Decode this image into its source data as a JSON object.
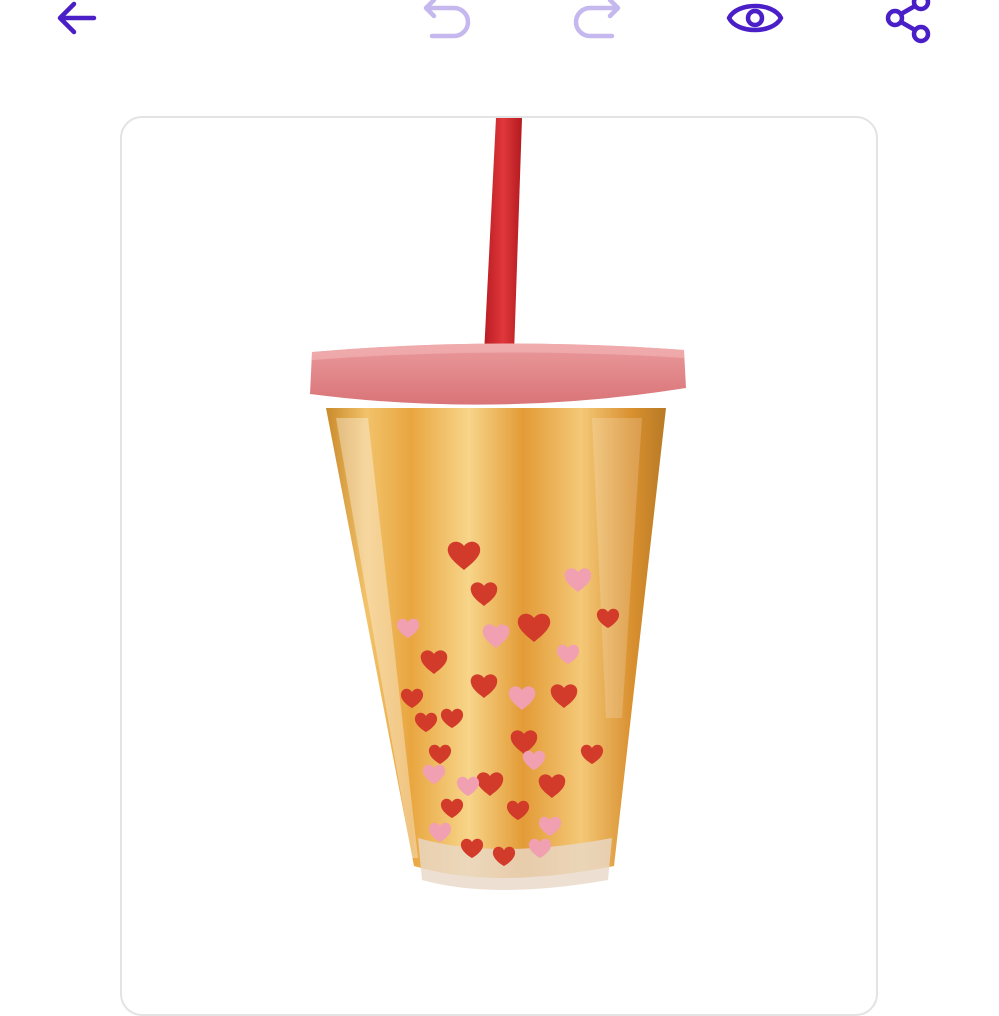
{
  "toolbar": {
    "back": {
      "icon": "arrow-left-icon",
      "enabled": true
    },
    "undo": {
      "icon": "undo-icon",
      "enabled": false
    },
    "redo": {
      "icon": "redo-icon",
      "enabled": false
    },
    "preview": {
      "icon": "eye-icon",
      "enabled": true
    },
    "share": {
      "icon": "share-icon",
      "enabled": true
    }
  },
  "colors": {
    "accent": "#4a1fc7",
    "accent_disabled": "#c5b8ee",
    "card_border": "#e3e3e6",
    "straw": "#d7262b",
    "lid": "#e07f84",
    "cup_gold": "#e9a640",
    "heart_red": "#d23a2a",
    "heart_pink": "#f0a0b0"
  },
  "main": {
    "image": {
      "subject": "tumbler-cup-with-red-straw-and-hearts"
    }
  }
}
